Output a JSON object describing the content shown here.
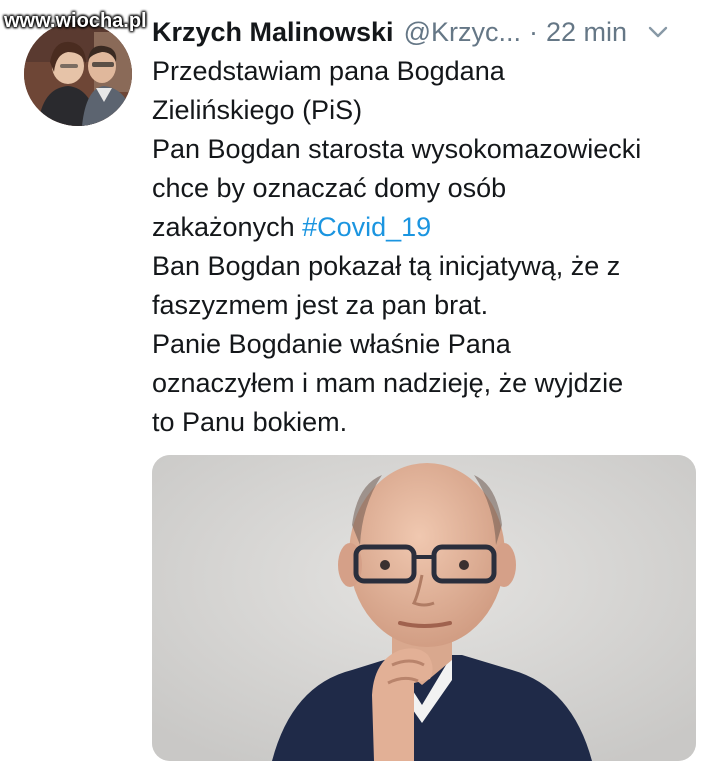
{
  "watermark": "www.wiocha.pl",
  "tweet": {
    "author_name": "Krzych Malinowski",
    "handle": "@Krzyc...",
    "separator": "·",
    "time": "22 min",
    "text_lines": [
      "Przedstawiam pana Bogdana",
      "Zielińskiego (PiS)",
      "Pan Bogdan starosta wysokomazowiecki",
      "chce by oznaczać domy osób",
      "zakażonych",
      "Ban Bogdan pokazał tą inicjatywą, że z",
      "faszyzmem jest za pan brat.",
      "Panie Bogdanie właśnie Pana",
      "oznaczyłem i mam nadzieję, że wyjdzie",
      "to Panu bokiem."
    ],
    "hashtag": "#Covid_19"
  },
  "icons": {
    "menu": "chevron-down-icon",
    "avatar": "avatar"
  },
  "colors": {
    "text": "#14171a",
    "secondary": "#657786",
    "link": "#1b95e0"
  }
}
